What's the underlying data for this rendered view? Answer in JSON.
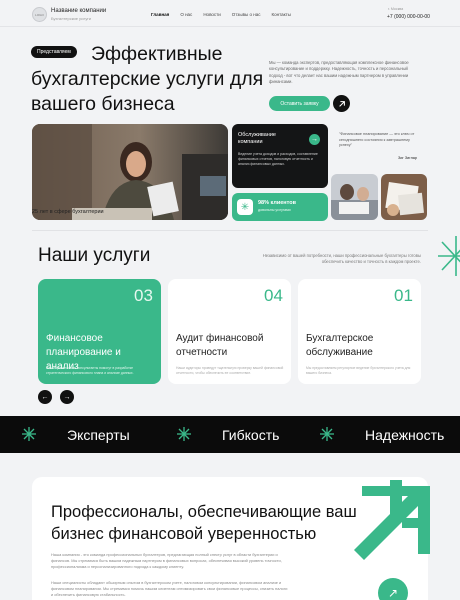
{
  "header": {
    "logo_text": "LOGO",
    "company_name": "Название компании",
    "company_sub": "Бухгалтерские услуги",
    "nav": [
      "Главная",
      "О нас",
      "Новости",
      "Отзывы о нас",
      "Контакты"
    ],
    "city": "г. Москва",
    "phone": "+7 (000) 000-00-00"
  },
  "hero": {
    "badge": "Представляем",
    "title": "Эффективные бухгалтерские услуги для вашего бизнеса",
    "description": "Мы — команда экспертов, предоставляющая комплексное финансовое консультирование и поддержку. Надежность, точность и персональный подход - вот что делает нас вашим надежным партнером в управлении финансами.",
    "cta_label": "Оставить заявку",
    "experience": "25 лет в сфере бухгалтерии",
    "service_card": {
      "title": "Обслуживание компании",
      "description": "Ведение учета доходов и расходов, составление финансовых отчетов, налоговую отчетность и анализ финансовых данных."
    },
    "clients": {
      "count": "98% клиентов",
      "sub": "довольны услугами"
    },
    "quote": "\"Финансовое планирование — это ключ от сегодняшнего состояния к завтрашнему успеху\"",
    "quote_author": "Зиг Зиглар"
  },
  "services": {
    "title": "Наши услуги",
    "description": "Независимо от вашей потребности, наши профессиональные бухгалтеры готовы обеспечить качество и точность в каждом проекте.",
    "cards": [
      {
        "num": "03",
        "title": "Финансовое планирование и анализ",
        "desc": "Наши финансовые консультанты помогут в разработке стратегического финансового плана и анализе данных."
      },
      {
        "num": "04",
        "title": "Аудит финансовой отчетности",
        "desc": "Наши аудиторы проведут тщательную проверку вашей финансовой отчетности, чтобы обеспечить ее соответствие."
      },
      {
        "num": "01",
        "title": "Бухгалтерское обслуживание",
        "desc": "Мы предоставляем регулярное ведение бухгалтерского учета для вашего бизнеса."
      }
    ],
    "prev_icon": "←",
    "next_icon": "→"
  },
  "band": {
    "words": [
      "Эксперты",
      "Гибкость",
      "Надежность"
    ]
  },
  "pro": {
    "title": "Профессионалы, обеспечивающие ваш бизнес финансовой уверенностью",
    "p1": "Наша компания - это команда профессиональных бухгалтеров, предлагающая полный спектр услуг в области бухгалтерии и финансов. Мы стремимся быть вашим надежным партнером в финансовых вопросах, обеспечивая высокий уровень точности, профессионализма и персонализированного подхода к каждому клиенту.",
    "p2": "Наши специалисты обладают обширным опытом в бухгалтерском учете, налоговом консультировании, финансовом анализе и финансовом планировании. Мы стремимся помочь нашим клиентам оптимизировать свои финансовые процессы, снизить налоги и обеспечить финансовую стабильность.",
    "button_icon": "↗"
  },
  "colors": {
    "accent": "#3ab88a",
    "dark": "#111111",
    "background": "#f2f3f5"
  }
}
